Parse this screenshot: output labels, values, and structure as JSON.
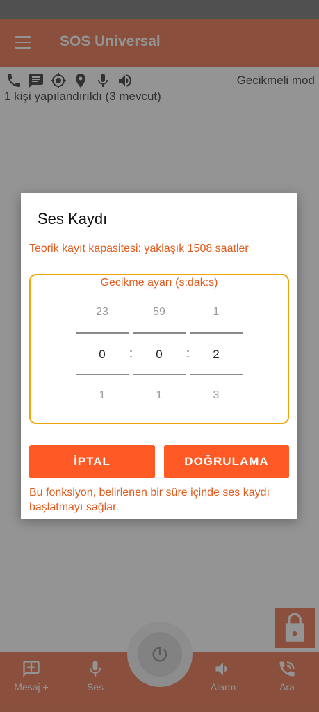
{
  "colors": {
    "accent": "#ff5a26",
    "appbar": "#ee8a6a",
    "timer_border": "#f0a50a",
    "warning_text": "#e25a1c"
  },
  "app_bar": {
    "title": "SOS Universal",
    "menu_icon": "hamburger-icon"
  },
  "status": {
    "mode": "Gecikmeli mod",
    "contacts": "1 kişi yapılandırıldı (3 mevcut)",
    "icons": [
      "phone-icon",
      "message-icon",
      "gps-icon",
      "location-pin-icon",
      "microphone-icon",
      "speaker-icon"
    ]
  },
  "dialog": {
    "title": "Ses Kaydı",
    "capacity": "Teorik kayıt kapasitesi: yaklaşık 1508 saatler",
    "timer_caption": "Gecikme ayarı (s:dak:s)",
    "hours": {
      "prev": "23",
      "current": "0",
      "next": "1"
    },
    "minutes": {
      "prev": "59",
      "current": "0",
      "next": "1"
    },
    "seconds": {
      "prev": "1",
      "current": "2",
      "next": "3"
    },
    "separator": ":",
    "cancel_label": "İPTAL",
    "confirm_label": "DOĞRULAMA",
    "info": "Bu fonksiyon, belirlenen bir süre içinde ses kaydı başlatmayı sağlar."
  },
  "bottom_nav": {
    "items": [
      {
        "label": "Mesaj +",
        "icon": "add-message-icon"
      },
      {
        "label": "Ses",
        "icon": "microphone-icon"
      },
      {
        "label": "Alarm",
        "icon": "speaker-icon"
      },
      {
        "label": "Ara",
        "icon": "phone-incoming-icon"
      }
    ],
    "center_icon": "power-icon"
  },
  "lock_icon": "lock-icon"
}
